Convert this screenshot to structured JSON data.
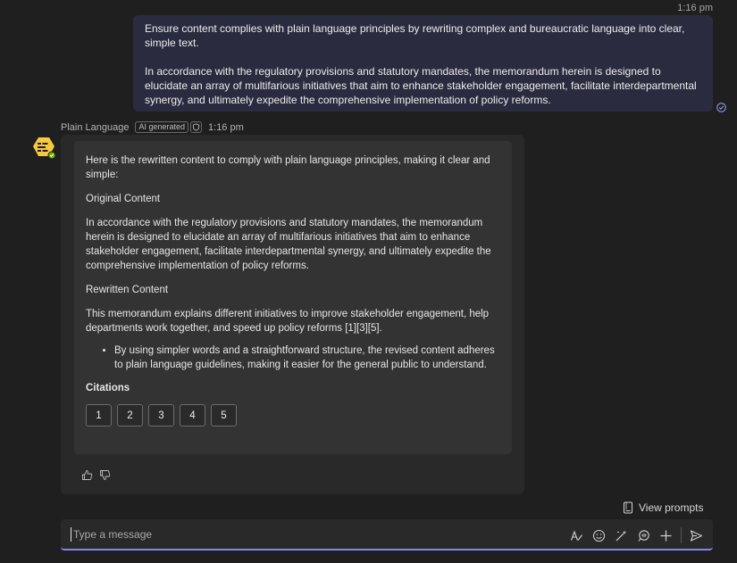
{
  "user_message": {
    "time": "1:16 pm",
    "paragraphs": [
      "Ensure content complies with plain language principles by rewriting complex and bureaucratic language into clear, simple text.",
      "In accordance with the regulatory provisions and statutory mandates, the memorandum herein is designed to elucidate an array of multifarious initiatives that aim to enhance stakeholder engagement, facilitate interdepartmental synergy, and ultimately expedite the comprehensive implementation of policy reforms."
    ]
  },
  "bot": {
    "name": "Plain Language",
    "badge": "AI generated",
    "time": "1:16 pm",
    "intro": "Here is the rewritten content to comply with plain language principles, making it clear and simple:",
    "original_heading": "Original Content",
    "original_text": "In accordance with the regulatory provisions and statutory mandates, the memorandum herein is designed to elucidate an array of multifarious initiatives that aim to enhance stakeholder engagement, facilitate interdepartmental synergy, and ultimately expedite the comprehensive implementation of policy reforms.",
    "rewritten_heading": "Rewritten Content",
    "rewritten_text": "This memorandum explains different initiatives to improve stakeholder engagement, help departments work together, and speed up policy reforms [1][3][5].",
    "bullet": "By using simpler words and a straightforward structure, the revised content adheres to plain language guidelines, making it easier for the general public to understand.",
    "citations_heading": "Citations",
    "citations": [
      "1",
      "2",
      "3",
      "4",
      "5"
    ]
  },
  "view_prompts_label": "View prompts",
  "composer": {
    "placeholder": "Type a message"
  },
  "colors": {
    "accent": "#7f85f5",
    "user_bubble": "#2b2b40",
    "avatar": "#f7c93e"
  }
}
